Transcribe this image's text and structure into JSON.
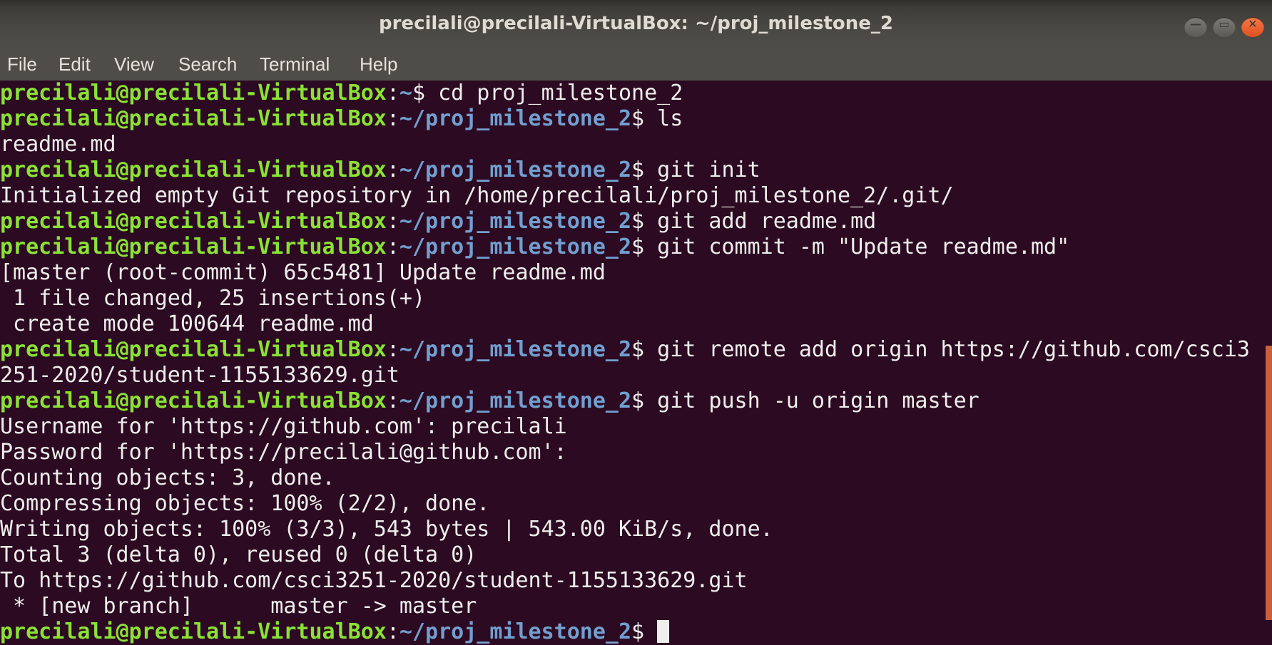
{
  "window": {
    "title": "precilali@precilali-VirtualBox: ~/proj_milestone_2",
    "buttons": [
      {
        "name": "minimize",
        "glyph": "—"
      },
      {
        "name": "maximize",
        "glyph": "▭"
      },
      {
        "name": "close",
        "glyph": "✕"
      }
    ]
  },
  "menu": [
    "File",
    "Edit",
    "View",
    "Search",
    "Terminal",
    "Help"
  ],
  "colors": {
    "background": "#2c0a22",
    "user": "#8ae234",
    "path": "#729fcf",
    "text": "#eeeeec",
    "scrollbar": "#c8603e"
  },
  "prompt_user": "precilali@precilali-VirtualBox",
  "lines": [
    {
      "type": "prompt",
      "path": "~",
      "cmd": "cd proj_milestone_2"
    },
    {
      "type": "prompt",
      "path": "~/proj_milestone_2",
      "cmd": "ls"
    },
    {
      "type": "out",
      "text": "readme.md"
    },
    {
      "type": "prompt",
      "path": "~/proj_milestone_2",
      "cmd": "git init"
    },
    {
      "type": "out",
      "text": "Initialized empty Git repository in /home/precilali/proj_milestone_2/.git/"
    },
    {
      "type": "prompt",
      "path": "~/proj_milestone_2",
      "cmd": "git add readme.md"
    },
    {
      "type": "prompt",
      "path": "~/proj_milestone_2",
      "cmd": "git commit -m \"Update readme.md\""
    },
    {
      "type": "out",
      "text": "[master (root-commit) 65c5481] Update readme.md"
    },
    {
      "type": "out",
      "text": " 1 file changed, 25 insertions(+)"
    },
    {
      "type": "out",
      "text": " create mode 100644 readme.md"
    },
    {
      "type": "prompt",
      "path": "~/proj_milestone_2",
      "cmd": "git remote add origin https://github.com/csci3"
    },
    {
      "type": "out",
      "text": "251-2020/student-1155133629.git"
    },
    {
      "type": "prompt",
      "path": "~/proj_milestone_2",
      "cmd": "git push -u origin master"
    },
    {
      "type": "out",
      "text": "Username for 'https://github.com': precilali"
    },
    {
      "type": "out",
      "text": "Password for 'https://precilali@github.com':"
    },
    {
      "type": "out",
      "text": "Counting objects: 3, done."
    },
    {
      "type": "out",
      "text": "Compressing objects: 100% (2/2), done."
    },
    {
      "type": "out",
      "text": "Writing objects: 100% (3/3), 543 bytes | 543.00 KiB/s, done."
    },
    {
      "type": "out",
      "text": "Total 3 (delta 0), reused 0 (delta 0)"
    },
    {
      "type": "out",
      "text": "To https://github.com/csci3251-2020/student-1155133629.git"
    },
    {
      "type": "out",
      "text": " * [new branch]      master -> master"
    },
    {
      "type": "prompt",
      "path": "~/proj_milestone_2",
      "cmd": "",
      "cursor": true
    }
  ]
}
